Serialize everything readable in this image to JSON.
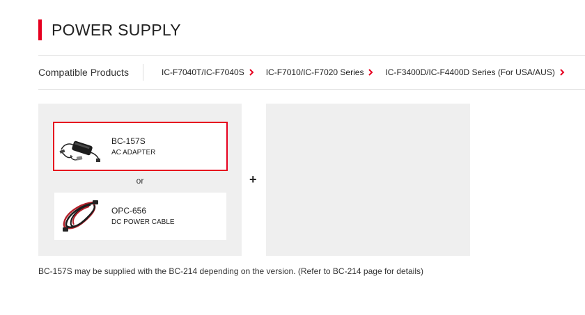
{
  "header": {
    "title": "POWER SUPPLY",
    "accent_color": "#e6001f"
  },
  "compatible": {
    "label": "Compatible Products",
    "links": [
      {
        "label": "IC-F7040T/IC-F7040S",
        "icon": "chevron-right-icon"
      },
      {
        "label": "IC-F7010/IC-F7020 Series",
        "icon": "chevron-right-icon"
      },
      {
        "label": "IC-F3400D/IC-F4400D Series (For USA/AUS)",
        "icon": "chevron-right-icon"
      }
    ]
  },
  "products": [
    {
      "name": "BC-157S",
      "description": "AC ADAPTER",
      "selected": true,
      "icon": "ac-adapter-image"
    },
    {
      "name": "OPC-656",
      "description": "DC POWER CABLE",
      "selected": false,
      "icon": "power-cable-image"
    }
  ],
  "or_label": "or",
  "plus_label": "+",
  "footnote": "BC-157S may be supplied with the BC-214 depending on the version. (Refer to BC-214 page for details)"
}
